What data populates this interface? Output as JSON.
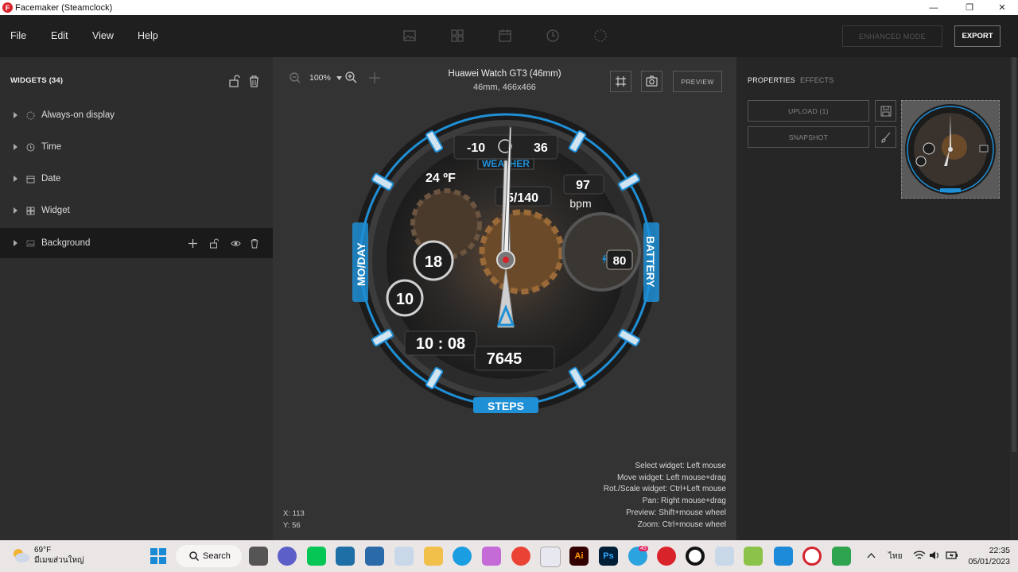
{
  "titlebar": {
    "title": "Facemaker (Steamclock)",
    "app_icon_letter": "F",
    "minimize": "—",
    "restore": "❐",
    "close": "✕"
  },
  "menu": {
    "items": [
      "File",
      "Edit",
      "View",
      "Help"
    ]
  },
  "toolbar": {
    "enhanced_mode": "ENHANCED MODE",
    "export": "EXPORT"
  },
  "widgets_panel": {
    "header": "WIDGETS  (34)",
    "items": [
      {
        "label": "Always-on display",
        "icon": "dotted-circle-icon"
      },
      {
        "label": "Time",
        "icon": "clock-icon"
      },
      {
        "label": "Date",
        "icon": "calendar-icon"
      },
      {
        "label": "Widget",
        "icon": "grid-icon"
      },
      {
        "label": "Background",
        "icon": "image-icon"
      }
    ]
  },
  "canvas": {
    "zoom": "100%",
    "device_name": "Huawei Watch GT3 (46mm)",
    "device_size": "46mm, 466x466",
    "preview": "PREVIEW",
    "hints": [
      "Select widget: Left mouse",
      "Move widget: Left mouse+drag",
      "Rot./Scale widget: Ctrl+Left mouse",
      "Pan: Right mouse+drag",
      "Preview: Shift+mouse wheel",
      "Zoom: Ctrl+mouse wheel"
    ],
    "coord_x": "X: 113",
    "coord_y": "Y: 56"
  },
  "watchface": {
    "temp_low": "-10",
    "temp_high": "36",
    "weather_label": "WEATHER",
    "temperature": "24 ºF",
    "pressure": "5/140",
    "heart_rate": "97",
    "heart_unit": "bpm",
    "month_day_label": "MO/DAY",
    "month": "18",
    "day": "10",
    "battery_label": "BATTERY",
    "battery": "80",
    "digital_time": "10 : 08",
    "steps": "7645",
    "steps_label": "STEPS"
  },
  "properties_panel": {
    "tab_properties": "PROPERTIES",
    "tab_effects": "EFFECTS",
    "upload": "UPLOAD (1)",
    "snapshot": "SNAPSHOT"
  },
  "taskbar": {
    "weather_temp": "69°F",
    "weather_desc": "มีเมฆส่วนใหญ่",
    "search": "Search",
    "language": "ไทย",
    "time": "22:35",
    "date": "05/01/2023",
    "telegram_badge": "45"
  },
  "colors": {
    "accent_blue": "#1f8fd6",
    "facemaker_red": "#d9232a"
  }
}
